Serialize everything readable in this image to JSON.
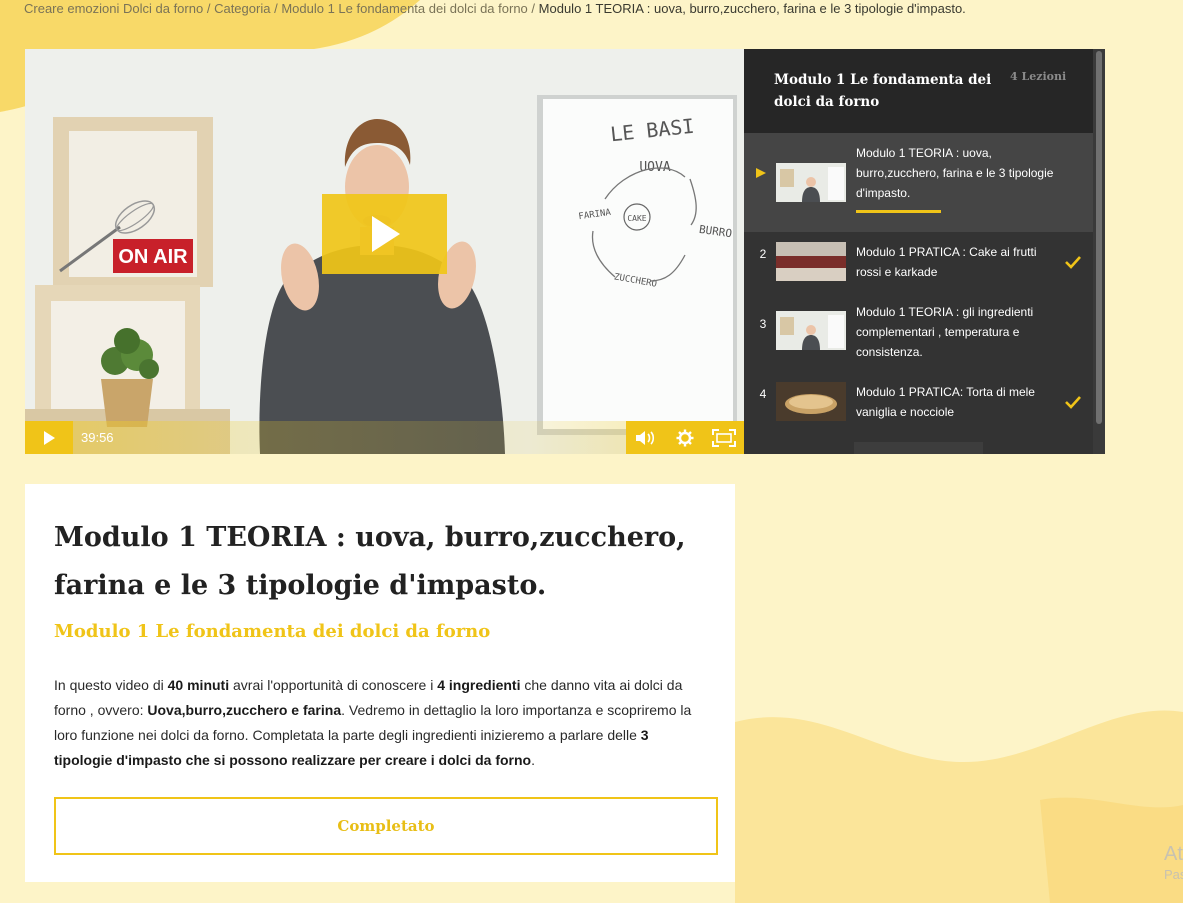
{
  "breadcrumb": {
    "items": [
      "Creare emozioni Dolci da forno",
      "Categoria",
      "Modulo 1 Le fondamenta dei dolci da forno"
    ],
    "separator": "/",
    "current": "Modulo 1 TEORIA : uova, burro,zucchero, farina e le 3 tipologie d'impasto."
  },
  "player": {
    "time": "39:56",
    "overlay_sign": "ON AIR",
    "board_heading": "LE BASI",
    "board_words": [
      "UOVA",
      "BURRO",
      "ZUCCHERO",
      "FARINA",
      "CAKE"
    ],
    "icons": {
      "big_play": "play-icon",
      "play": "play-icon",
      "volume": "volume-icon",
      "settings": "gear-icon",
      "fullscreen": "fullscreen-icon"
    }
  },
  "playlist": {
    "title": "Modulo 1 Le fondamenta dei dolci da forno",
    "count": "4 Lezioni",
    "items": [
      {
        "index": "",
        "title": "Modulo 1 TEORIA : uova, burro,zucchero, farina e le 3 tipologie d'impasto.",
        "active": true,
        "completed": false,
        "progress": 0.5
      },
      {
        "index": "2",
        "title": "Modulo 1 PRATICA : Cake ai frutti rossi e karkade",
        "active": false,
        "completed": true
      },
      {
        "index": "3",
        "title": "Modulo 1 TEORIA : gli ingredienti complementari , temperatura e consistenza.",
        "active": false,
        "completed": false
      },
      {
        "index": "4",
        "title": "Modulo 1 PRATICA: Torta di mele vaniglia e nocciole",
        "active": false,
        "completed": true
      }
    ]
  },
  "lesson": {
    "title": "Modulo 1 TEORIA : uova, burro,zucchero, farina e le 3 tipologie d'impasto.",
    "module": "Modulo 1 Le fondamenta dei dolci da forno",
    "description": {
      "p1": "In questo video di ",
      "b1": "40 minuti",
      "p2": " avrai l'opportunità di conoscere i ",
      "b2": "4 ingredienti",
      "p3": " che danno vita ai dolci da forno , ovvero: ",
      "b3": "Uova,burro,zucchero e farina",
      "p4": ". Vedremo in dettaglio la loro importanza e scopriremo la loro funzione nei dolci da forno. Completata la parte degli ingredienti inizieremo a parlare delle ",
      "b4": "3 tipologie d'impasto che si possono realizzare per creare i dolci da forno",
      "p5": "."
    },
    "complete_label": "Completato"
  },
  "watermark": {
    "line1": "At",
    "line2": "Pas"
  },
  "colors": {
    "accent": "#f0c418",
    "page_bg": "#fdf4c8",
    "wave": "#fbe59a",
    "playlist_bg": "#333333"
  }
}
